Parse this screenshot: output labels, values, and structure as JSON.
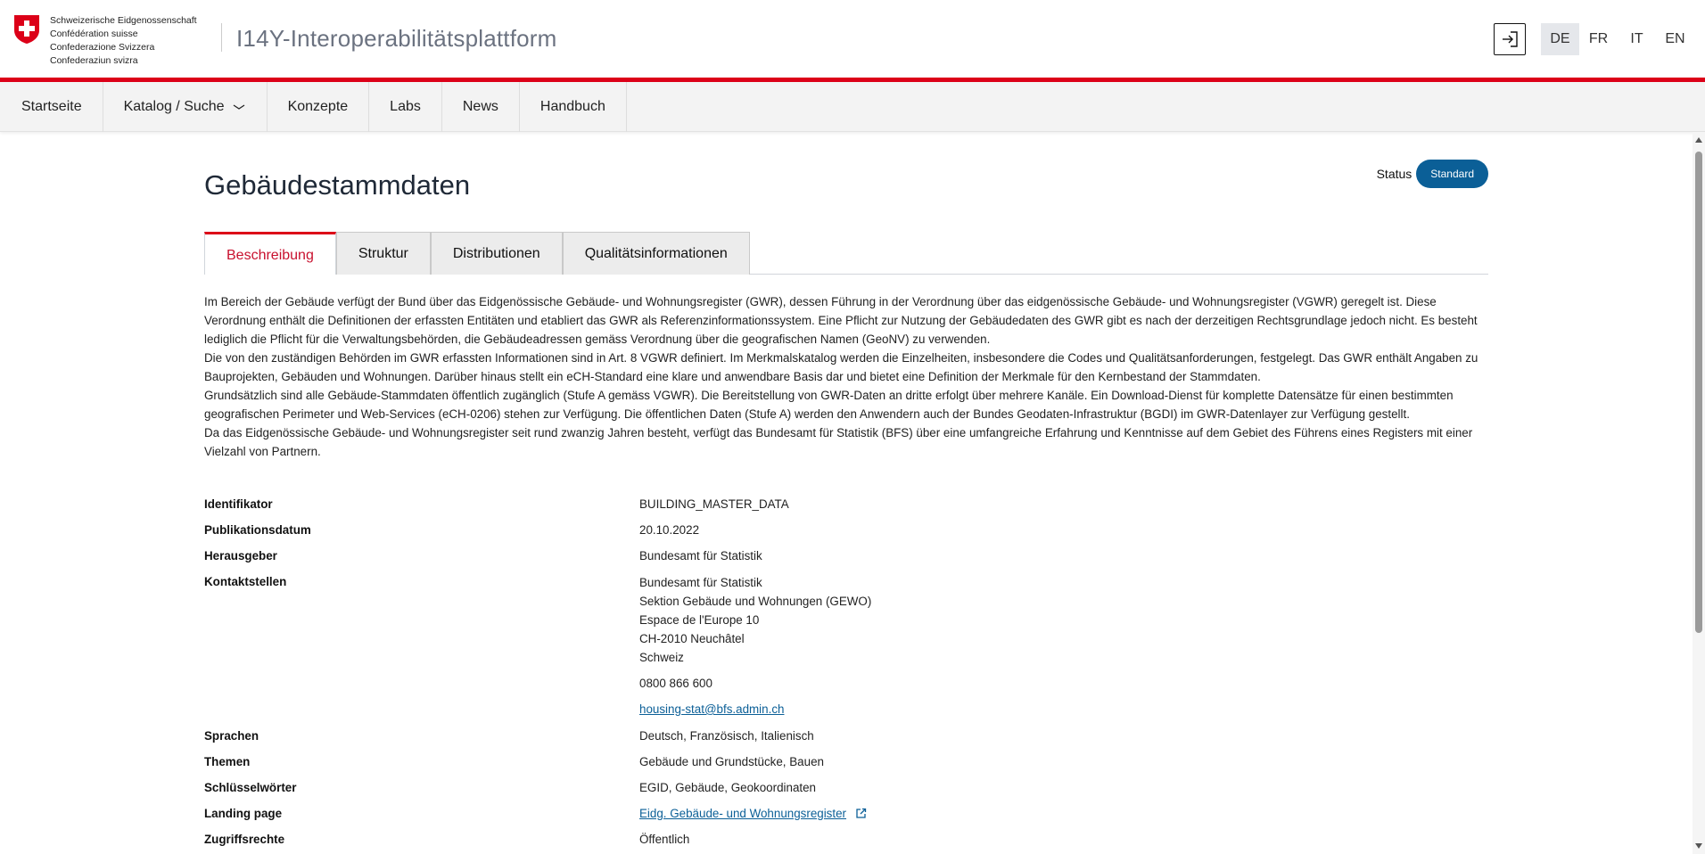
{
  "header": {
    "logo_lines": [
      "Schweizerische Eidgenossenschaft",
      "Confédération suisse",
      "Confederazione Svizzera",
      "Confederaziun svizra"
    ],
    "site_title": "I14Y-Interoperabilitätsplattform",
    "languages": [
      "DE",
      "FR",
      "IT",
      "EN"
    ],
    "active_language": "DE",
    "brand_red": "#dc0018"
  },
  "nav": {
    "items": [
      "Startseite",
      "Katalog / Suche",
      "Konzepte",
      "Labs",
      "News",
      "Handbuch"
    ]
  },
  "page": {
    "title": "Gebäudestammdaten",
    "status_label": "Status",
    "status_value": "Standard",
    "status_color": "#0b5f97"
  },
  "tabs": [
    "Beschreibung",
    "Struktur",
    "Distributionen",
    "Qualitätsinformationen"
  ],
  "active_tab": "Beschreibung",
  "description": [
    "Im Bereich der Gebäude verfügt der Bund über das Eidgenössische Gebäude- und Wohnungsregister (GWR), dessen Führung in der Verordnung über das eidgenössische Gebäude- und Wohnungsregister (VGWR) geregelt ist. Diese Verordnung enthält die Definitionen der erfassten Entitäten und etabliert das GWR als Referenzinformationssystem. Eine Pflicht zur Nutzung der Gebäudedaten des GWR gibt es nach der derzeitigen Rechtsgrundlage jedoch nicht. Es besteht lediglich die Pflicht für die Verwaltungsbehörden, die Gebäudeadressen gemäss Verordnung über die geografischen Namen (GeoNV) zu verwenden.",
    "Die von den zuständigen Behörden im GWR erfassten Informationen sind in Art. 8 VGWR definiert. Im Merkmalskatalog werden die Einzelheiten, insbesondere die Codes und Qualitätsanforderungen, festgelegt. Das GWR enthält Angaben zu Bauprojekten, Gebäuden und Wohnungen. Darüber hinaus stellt ein eCH-Standard eine klare und anwendbare Basis dar und bietet eine Definition der Merkmale für den Kernbestand der Stammdaten.",
    "Grundsätzlich sind alle Gebäude-Stammdaten öffentlich zugänglich (Stufe A gemäss VGWR). Die Bereitstellung von GWR-Daten an dritte erfolgt über mehrere Kanäle. Ein Download-Dienst für komplette Datensätze für einen bestimmten geografischen Perimeter und Web-Services (eCH-0206) stehen zur Verfügung. Die öffentlichen Daten (Stufe A) werden den Anwendern auch der Bundes Geodaten-Infrastruktur (BGDI) im GWR-Datenlayer zur Verfügung gestellt.",
    "Da das Eidgenössische Gebäude- und Wohnungsregister seit rund zwanzig Jahren besteht, verfügt das Bundesamt für Statistik (BFS) über eine umfangreiche Erfahrung und Kenntnisse auf dem Gebiet des Führens eines Registers mit einer Vielzahl von Partnern."
  ],
  "metadata": {
    "identifikator_label": "Identifikator",
    "identifikator": "BUILDING_MASTER_DATA",
    "publikationsdatum_label": "Publikationsdatum",
    "publikationsdatum": "20.10.2022",
    "herausgeber_label": "Herausgeber",
    "herausgeber": "Bundesamt für Statistik",
    "kontaktstellen_label": "Kontaktstellen",
    "kontakt": {
      "org": "Bundesamt für Statistik",
      "sektion": "Sektion Gebäude und Wohnungen (GEWO)",
      "strasse": "Espace de l'Europe 10",
      "ort": "CH-2010 Neuchâtel",
      "land": "Schweiz",
      "telefon": "0800 866 600",
      "email": "housing-stat@bfs.admin.ch"
    },
    "sprachen_label": "Sprachen",
    "sprachen": "Deutsch, Französisch, Italienisch",
    "themen_label": "Themen",
    "themen": "Gebäude und Grundstücke, Bauen",
    "schluesselwoerter_label": "Schlüsselwörter",
    "schluesselwoerter": "EGID, Gebäude, Geokoordinaten",
    "landing_page_label": "Landing page",
    "landing_page": "Eidg. Gebäude- und Wohnungsregister",
    "zugriffsrechte_label": "Zugriffsrechte",
    "zugriffsrechte": "Öffentlich"
  },
  "icons": {
    "login": "login-icon",
    "external": "external-link-icon",
    "chevron": "chevron-down-icon"
  }
}
